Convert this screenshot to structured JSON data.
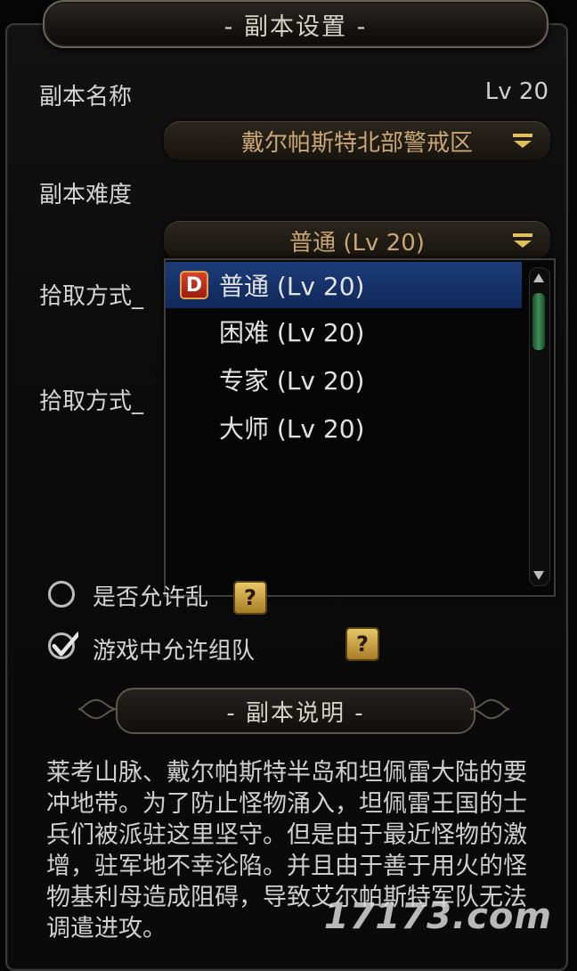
{
  "window": {
    "title": "- 副本设置 -"
  },
  "instance_name": {
    "label": "副本名称",
    "level": "Lv 20",
    "selected": "戴尔帕斯特北部警戒区"
  },
  "difficulty": {
    "label": "副本难度",
    "selected": "普通 (Lv 20)",
    "options": [
      {
        "badge": "D",
        "label": "普通 (Lv 20)"
      },
      {
        "label": "困难 (Lv 20)"
      },
      {
        "label": "专家 (Lv 20)"
      },
      {
        "label": "大师 (Lv 20)"
      }
    ]
  },
  "loot": {
    "label1": "拾取方式_",
    "label2": "拾取方式_"
  },
  "options": {
    "allow_chaos_label": "是否允许乱",
    "allow_party_label": "游戏中允许组队",
    "help": "?"
  },
  "description": {
    "title": "- 副本说明 -",
    "text": "莱考山脉、戴尔帕斯特半岛和坦佩雷大陆的要冲地带。为了防止怪物涌入，坦佩雷王国的士兵们被派驻这里坚守。但是由于最近怪物的激增，驻军地不幸沦陷。并且由于善于用火的怪物基利母造成阻碍，导致艾尔帕斯特军队无法调遣进攻。"
  },
  "watermark": "17173.com",
  "colors": {
    "selection": "#10285a",
    "accent_gold": "#c9a673",
    "scroll_thumb": "#3f8f56"
  }
}
